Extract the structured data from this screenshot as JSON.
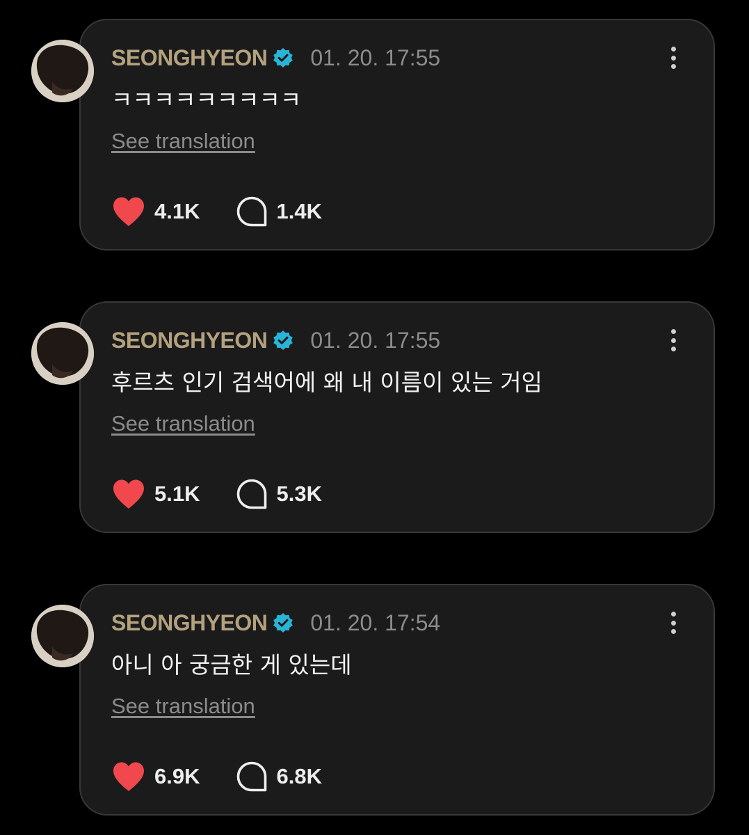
{
  "posts": [
    {
      "username": "SEONGHYEON",
      "timestamp": "01. 20. 17:55",
      "content": "ㅋㅋㅋㅋㅋㅋㅋㅋㅋ",
      "translate_label": "See translation",
      "likes": "4.1K",
      "comments": "1.4K"
    },
    {
      "username": "SEONGHYEON",
      "timestamp": "01. 20. 17:55",
      "content": "후르츠 인기 검색어에 왜 내 이름이 있는 거임",
      "translate_label": "See translation",
      "likes": "5.1K",
      "comments": "5.3K"
    },
    {
      "username": "SEONGHYEON",
      "timestamp": "01. 20. 17:54",
      "content": "아니 아 궁금한 게 있는데",
      "translate_label": "See translation",
      "likes": "6.9K",
      "comments": "6.8K"
    }
  ],
  "icons": {
    "verified": "verified-badge-icon",
    "more": "more-vertical-icon",
    "like": "heart-icon",
    "comment": "comment-bubble-icon"
  },
  "colors": {
    "background": "#000000",
    "card": "#1b1b1b",
    "card_border": "#383838",
    "username": "#b4a27f",
    "verified": "#2ab3d6",
    "timestamp": "#8c8c8c",
    "heart": "#f0484d",
    "text": "#f2f2f2"
  }
}
